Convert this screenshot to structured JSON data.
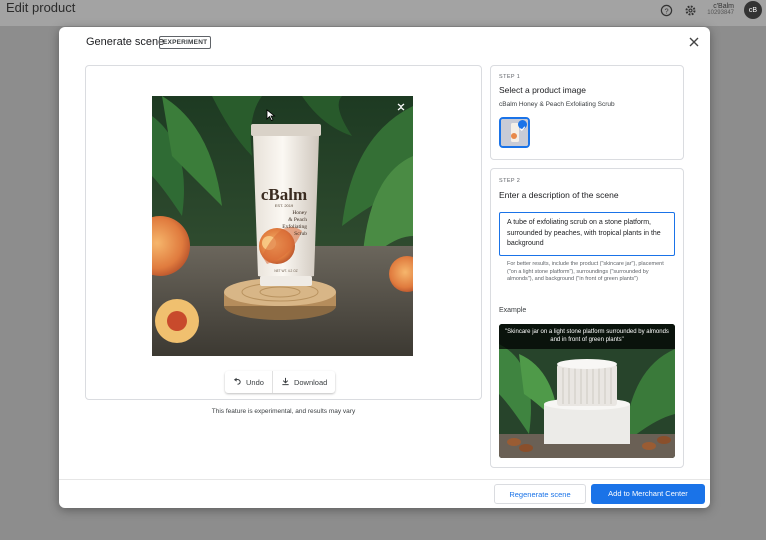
{
  "app": {
    "title": "Edit product",
    "account_name": "c'Balm",
    "account_id": "10293847",
    "avatar_initials": "cB"
  },
  "dialog": {
    "title": "Generate scene",
    "badge": "EXPERIMENT",
    "undo_label": "Undo",
    "download_label": "Download",
    "disclaimer": "This feature is experimental, and results may vary"
  },
  "step1": {
    "label": "STEP 1",
    "title": "Select a product image",
    "product_name": "cBalm Honey & Peach Exfoliating Scrub"
  },
  "step2": {
    "label": "STEP 2",
    "title": "Enter a description of the scene",
    "description": "A tube of exfoliating scrub on a stone platform, surrounded by peaches, with tropical plants in the background",
    "hint": "For better results, include the product (\"skincare jar\"), placement (\"on a light stone platform\"), surroundings (\"surrounded by almonds\"), and background (\"in front of green plants\")",
    "example_label": "Example",
    "example_caption": "\"Skincare jar on a light stone platform surrounded by almonds and in front of green plants\""
  },
  "product": {
    "brand": "cBalm",
    "brand_sub": "EST. 2019",
    "text_line1": "Honey",
    "text_line2": "& Peach",
    "text_line3": "Exfoliating",
    "text_line4": "Scrub",
    "footer_text": "NET WT. 4.2 OZ"
  },
  "footer": {
    "regenerate_label": "Regenerate scene",
    "add_label": "Add to Merchant Center"
  },
  "colors": {
    "primary": "#1a73e8",
    "overlay": "#8d8d8d"
  }
}
